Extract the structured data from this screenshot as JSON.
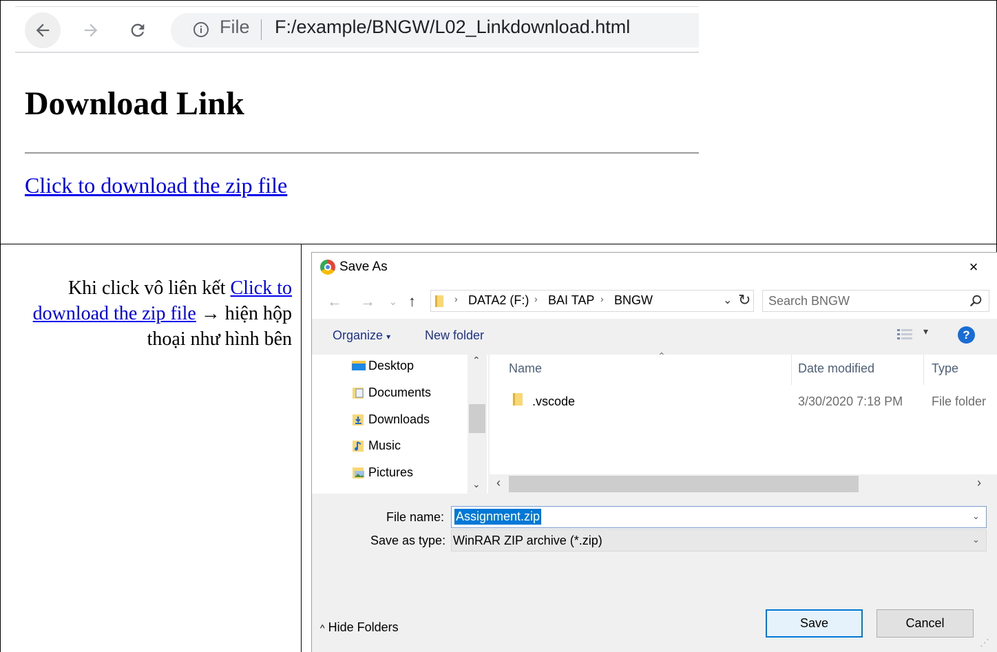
{
  "browser": {
    "omnibox_file_label": "File",
    "url": "F:/example/BNGW/L02_Linkdownload.html"
  },
  "page": {
    "heading": "Download Link",
    "link_text": "Click to download the zip file"
  },
  "description": {
    "text_before": "Khi click vô liên kết ",
    "link_text": "Click to download the zip file",
    "arrow": "→",
    "text_after": " hiện hộp thoại như hình bên"
  },
  "dialog": {
    "title": "Save As",
    "close": "×",
    "breadcrumbs": [
      "DATA2 (F:)",
      "BAI TAP",
      "BNGW"
    ],
    "search_placeholder": "Search BNGW",
    "organize": "Organize",
    "new_folder": "New folder",
    "help": "?",
    "nav_items": [
      {
        "label": "Desktop",
        "icon": "desktop-icon"
      },
      {
        "label": "Documents",
        "icon": "documents-icon"
      },
      {
        "label": "Downloads",
        "icon": "downloads-icon"
      },
      {
        "label": "Music",
        "icon": "music-icon"
      },
      {
        "label": "Pictures",
        "icon": "pictures-icon"
      }
    ],
    "columns": [
      "Name",
      "Date modified",
      "Type"
    ],
    "files": [
      {
        "name": ".vscode",
        "date": "3/30/2020 7:18 PM",
        "type": "File folder"
      }
    ],
    "file_name_label": "File name:",
    "file_name_value": "Assignment.zip",
    "save_type_label": "Save as type:",
    "save_type_value": "WinRAR ZIP archive (*.zip)",
    "hide_folders": "Hide Folders",
    "save_button": "Save",
    "cancel_button": "Cancel"
  }
}
